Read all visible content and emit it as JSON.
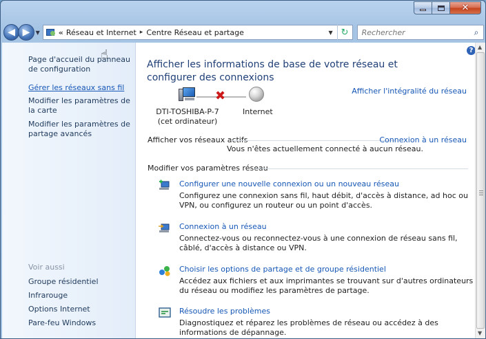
{
  "window": {
    "close": "✕",
    "minimize": "–",
    "maximize": "□"
  },
  "address": {
    "overflow": "«",
    "crumbs": [
      "Réseau et Internet",
      "Centre Réseau et partage"
    ],
    "separator": "▸"
  },
  "search": {
    "placeholder": "Rechercher"
  },
  "nav": {
    "home": "Page d'accueil du panneau de configuration",
    "items": [
      "Gérer les réseaux sans fil",
      "Modifier les paramètres de la carte",
      "Modifier les paramètres de partage avancés"
    ],
    "see_also_title": "Voir aussi",
    "see_also": [
      "Groupe résidentiel",
      "Infrarouge",
      "Options Internet",
      "Pare-feu Windows"
    ]
  },
  "main": {
    "title": "Afficher les informations de base de votre réseau et configurer des connexions",
    "full_map_link": "Afficher l'intégralité du réseau",
    "computer_name": "DTI-TOSHIBA-P-7",
    "computer_sub": "(cet ordinateur)",
    "internet_label": "Internet",
    "active_networks_label": "Afficher vos réseaux actifs",
    "connect_link": "Connexion à un réseau",
    "not_connected": "Vous n'êtes actuellement connecté à aucun réseau.",
    "modify_label": "Modifier vos paramètres réseau",
    "tasks": [
      {
        "link": "Configurer une nouvelle connexion ou un nouveau réseau",
        "desc": "Configurez une connexion sans fil, haut débit, d'accès à distance, ad hoc ou VPN, ou configurez un routeur ou un point d'accès.",
        "icon": "new-connection-icon"
      },
      {
        "link": "Connexion à un réseau",
        "desc": "Connectez-vous ou reconnectez-vous à une connexion de réseau sans fil, câblé, d'accès à distance ou VPN.",
        "icon": "connect-network-icon"
      },
      {
        "link": "Choisir les options de partage et de groupe résidentiel",
        "desc": "Accédez aux fichiers et aux imprimantes se trouvant sur d'autres ordinateurs du réseau ou modifiez les paramètres de partage.",
        "icon": "homegroup-icon"
      },
      {
        "link": "Résoudre les problèmes",
        "desc": "Diagnostiquez et réparez les problèmes de réseau ou accédez à des informations de dépannage.",
        "icon": "troubleshoot-icon"
      }
    ]
  },
  "colors": {
    "link": "#1556b6",
    "nav_bg": "#e3edf9",
    "title": "#1f3f76",
    "disconnected": "#cc1a1a"
  }
}
